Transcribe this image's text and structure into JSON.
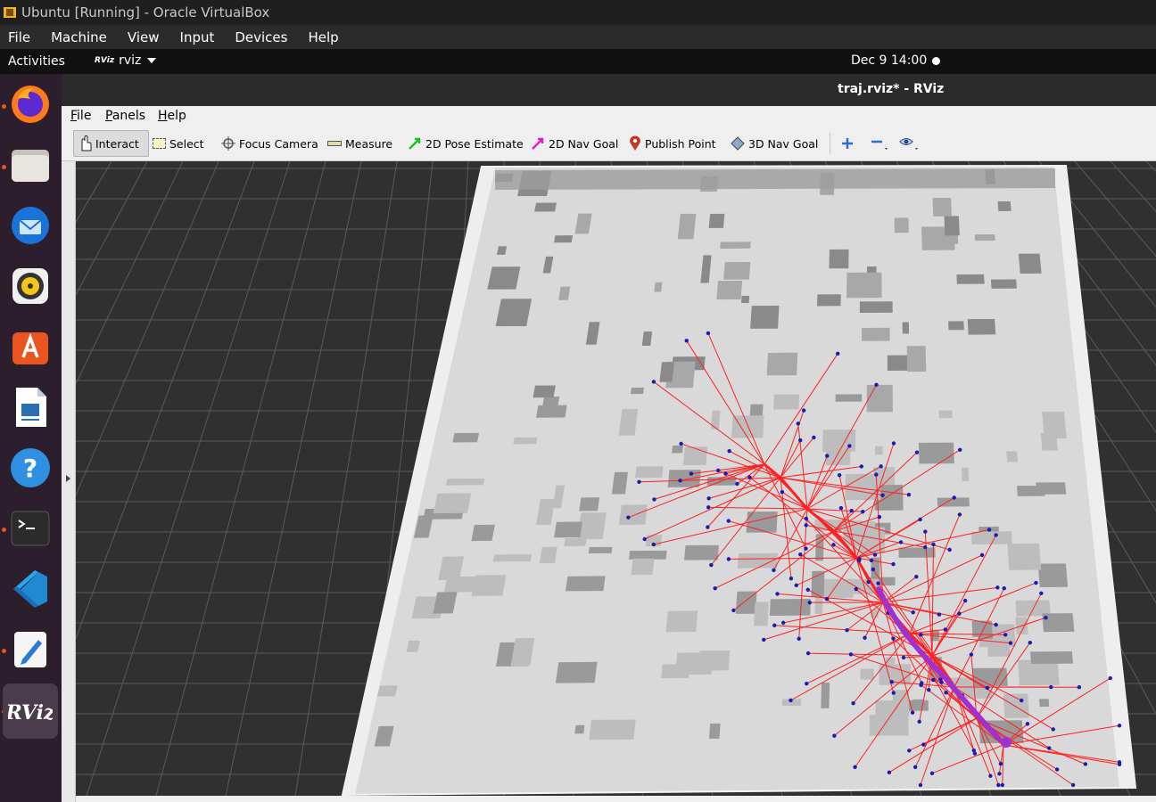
{
  "host_window": {
    "title": "Ubuntu [Running] - Oracle VirtualBox",
    "menu": [
      "File",
      "Machine",
      "View",
      "Input",
      "Devices",
      "Help"
    ]
  },
  "gnome_topbar": {
    "activities": "Activities",
    "app_name": "rviz",
    "app_logo": "RViz",
    "clock": "Dec 9  14:00"
  },
  "dock": {
    "items": [
      {
        "name": "firefox-icon",
        "running": true
      },
      {
        "name": "files-icon",
        "running": true
      },
      {
        "name": "thunderbird-icon",
        "running": false
      },
      {
        "name": "rhythmbox-icon",
        "running": false
      },
      {
        "name": "software-icon",
        "running": false
      },
      {
        "name": "writer-icon",
        "running": false
      },
      {
        "name": "help-icon",
        "running": false
      },
      {
        "name": "terminal-icon",
        "running": true
      },
      {
        "name": "vscode-icon",
        "running": false
      },
      {
        "name": "text-editor-icon",
        "running": true
      },
      {
        "name": "rviz-icon",
        "running": true,
        "active": true,
        "label": "RViz"
      }
    ]
  },
  "rviz": {
    "window_title": "traj.rviz* - RViz",
    "menu": [
      {
        "label": "File",
        "mnemonic": "F",
        "rest": "ile"
      },
      {
        "label": "Panels",
        "mnemonic": "P",
        "rest": "anels"
      },
      {
        "label": "Help",
        "mnemonic": "H",
        "rest": "elp"
      }
    ],
    "tools": {
      "interact": "Interact",
      "select": "Select",
      "focus_camera": "Focus Camera",
      "measure": "Measure",
      "pose_estimate": "2D Pose Estimate",
      "nav_goal": "2D Nav Goal",
      "publish_point": "Publish Point",
      "nav_goal_3d": "3D Nav Goal"
    },
    "colors": {
      "grid": "#5a5a5a",
      "map_floor": "#d9d9d9",
      "obstacle": "#8e8e8e",
      "edge": "#ff2020",
      "node": "#1a1ab4",
      "path": "#a030d0"
    }
  }
}
